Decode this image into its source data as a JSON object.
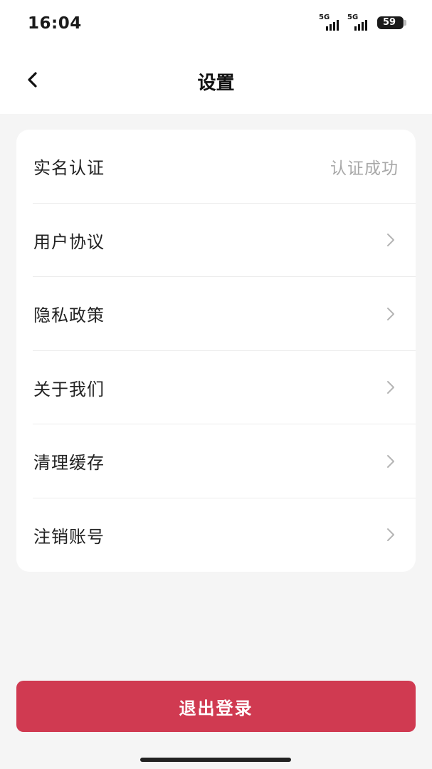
{
  "status_bar": {
    "time": "16:04",
    "network_1": "5G",
    "network_2": "5G",
    "battery": "59"
  },
  "nav": {
    "title": "设置",
    "back_icon": "chevron-left-icon"
  },
  "settings": {
    "items": [
      {
        "label": "实名认证",
        "value": "认证成功"
      },
      {
        "label": "用户协议",
        "icon": "chevron-right-icon"
      },
      {
        "label": "隐私政策",
        "icon": "chevron-right-icon"
      },
      {
        "label": "关于我们",
        "icon": "chevron-right-icon"
      },
      {
        "label": "清理缓存",
        "icon": "chevron-right-icon"
      },
      {
        "label": "注销账号",
        "icon": "chevron-right-icon"
      }
    ]
  },
  "logout": {
    "label": "退出登录"
  },
  "colors": {
    "accent": "#d03a51",
    "background": "#f5f5f5",
    "card": "#ffffff",
    "secondary_text": "#a8a8a8"
  }
}
